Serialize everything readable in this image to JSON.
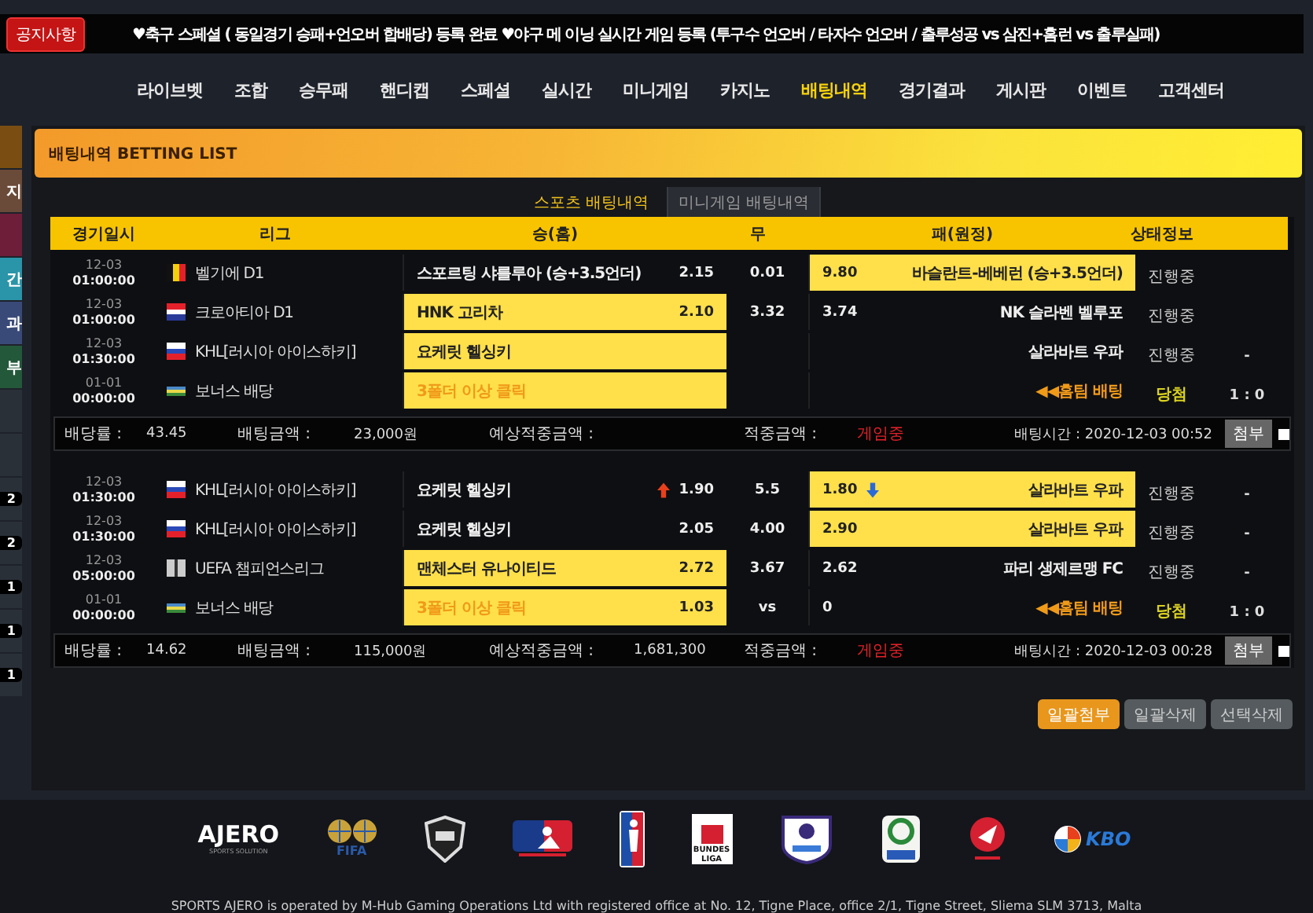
{
  "notice": {
    "badge": "공지사항",
    "text": "♥축구 스페셜 ( 동일경기 승패+언오버 합배당) 등록 완료  ♥야구 메 이닝 실시간 게임 등록 (투구수 언오버 / 타자수 언오버 / 출루성공 vs 삼진+홈런 vs 출루실패)"
  },
  "nav": [
    {
      "label": "라이브벳",
      "selected": false
    },
    {
      "label": "조합",
      "selected": false
    },
    {
      "label": "승무패",
      "selected": false
    },
    {
      "label": "핸디캡",
      "selected": false
    },
    {
      "label": "스페셜",
      "selected": false
    },
    {
      "label": "실시간",
      "selected": false
    },
    {
      "label": "미니게임",
      "selected": false
    },
    {
      "label": "카지노",
      "selected": false
    },
    {
      "label": "배팅내역",
      "selected": true
    },
    {
      "label": "경기결과",
      "selected": false
    },
    {
      "label": "게시판",
      "selected": false
    },
    {
      "label": "이벤트",
      "selected": false
    },
    {
      "label": "고객센터",
      "selected": false
    }
  ],
  "sidebar": [
    {
      "color": "#7a4e12"
    },
    {
      "label": "지",
      "color": "#6a4a38"
    },
    {
      "color": "#6e1e38"
    },
    {
      "label": "간",
      "color": "#2a94a8"
    },
    {
      "label": "과",
      "color": "#3a4a78"
    },
    {
      "label": "부",
      "color": "#24583a"
    },
    {
      "color": "#2a3038"
    },
    {
      "color": "#2a3038"
    },
    {
      "label": "2",
      "color": "#2a3038"
    },
    {
      "label": "2",
      "color": "#2a3038"
    },
    {
      "label": "1",
      "color": "#2a3038"
    },
    {
      "label": "1",
      "color": "#2a3038"
    },
    {
      "label": "1",
      "color": "#2a3038"
    }
  ],
  "page_title": "배팅내역 BETTING LIST",
  "tabs": [
    {
      "label": "스포츠 배팅내역",
      "selected": true
    },
    {
      "label": "미니게임 배팅내역",
      "selected": false
    }
  ],
  "columns": [
    "경기일시",
    "리그",
    "승(홈)",
    "무",
    "패(원정)",
    "상태정보"
  ],
  "bets": [
    {
      "rows": [
        {
          "date": "12-03",
          "time": "01:00:00",
          "flag": {
            "kind": "belgium"
          },
          "league": "벨기에 D1",
          "home": {
            "name": "스포르팅 샤를루아 (승+3.5언더)",
            "odds": "2.15",
            "selected": false,
            "kind": "team",
            "rising": false,
            "falling": false
          },
          "draw": "0.01",
          "away": {
            "name": "바슬란트-베베런 (승+3.5언더)",
            "odds": "9.80",
            "selected": true,
            "kind": "team",
            "rising": false,
            "falling": false
          },
          "status": "진행중",
          "won": false
        },
        {
          "date": "12-03",
          "time": "01:00:00",
          "flag": {
            "kind": "croatia"
          },
          "league": "크로아티아 D1",
          "home": {
            "name": "HNK 고리차",
            "odds": "2.10",
            "selected": true,
            "kind": "team",
            "rising": false,
            "falling": false
          },
          "draw": "3.32",
          "away": {
            "name": "NK 슬라벤 벨루포",
            "odds": "3.74",
            "selected": false,
            "kind": "team",
            "rising": false,
            "falling": false
          },
          "status": "진행중",
          "won": false
        },
        {
          "date": "12-03",
          "time": "01:30:00",
          "flag": {
            "kind": "russia"
          },
          "league": "KHL[러시아 아이스하키]",
          "home": {
            "name": "요케릿 헬싱키",
            "selected": true,
            "kind": "team",
            "rising": false,
            "falling": false
          },
          "away": {
            "name": "살라바트 우파",
            "selected": false,
            "kind": "team",
            "rising": false,
            "falling": false
          },
          "status": "진행중",
          "won": false,
          "score": "-"
        },
        {
          "date": "01-01",
          "time": "00:00:00",
          "flag": {
            "kind": "bonus"
          },
          "league": "보너스 배당",
          "home": {
            "name": "3폴더 이상 클릭",
            "selected": true,
            "kind": "bonus",
            "rising": false,
            "falling": false
          },
          "away": {
            "name": "◀◀홈팀 배팅",
            "selected": false,
            "kind": "bonus",
            "rising": false,
            "falling": false
          },
          "status": "당첨",
          "won": true,
          "score": "1 : 0"
        }
      ],
      "summary": {
        "rate_label": "배당률 :",
        "rate": "43.45",
        "amount_label": "배팅금액 :",
        "amount": "23,000원",
        "expected_label": "예상적중금액 :",
        "win_label": "적중금액 :",
        "win": "게임중",
        "time": "배팅시간 : 2020-12-03 00:52",
        "attach": "첨부",
        "checked": false
      }
    },
    {
      "rows": [
        {
          "date": "12-03",
          "time": "01:30:00",
          "flag": {
            "kind": "russia"
          },
          "league": "KHL[러시아 아이스하키]",
          "home": {
            "name": "요케릿 헬싱키",
            "odds": "1.90",
            "selected": false,
            "kind": "team",
            "rising": true,
            "falling": false
          },
          "draw": "5.5",
          "away": {
            "name": "살라바트 우파",
            "odds": "1.80",
            "selected": true,
            "kind": "team",
            "rising": false,
            "falling": true
          },
          "status": "진행중",
          "won": false,
          "score": "-"
        },
        {
          "date": "12-03",
          "time": "01:30:00",
          "flag": {
            "kind": "russia"
          },
          "league": "KHL[러시아 아이스하키]",
          "home": {
            "name": "요케릿 헬싱키",
            "odds": "2.05",
            "selected": false,
            "kind": "team",
            "rising": false,
            "falling": false
          },
          "draw": "4.00",
          "away": {
            "name": "살라바트 우파",
            "odds": "2.90",
            "selected": true,
            "kind": "team",
            "rising": false,
            "falling": false
          },
          "status": "진행중",
          "won": false,
          "score": "-"
        },
        {
          "date": "12-03",
          "time": "05:00:00",
          "flag": {
            "kind": "uefa"
          },
          "league": "UEFA 챔피언스리그",
          "home": {
            "name": "맨체스터 유나이티드",
            "odds": "2.72",
            "selected": true,
            "kind": "team",
            "rising": false,
            "falling": false
          },
          "draw": "3.67",
          "away": {
            "name": "파리 생제르맹 FC",
            "odds": "2.62",
            "selected": false,
            "kind": "team",
            "rising": false,
            "falling": false
          },
          "status": "진행중",
          "won": false,
          "score": "-"
        },
        {
          "date": "01-01",
          "time": "00:00:00",
          "flag": {
            "kind": "bonus"
          },
          "league": "보너스 배당",
          "home": {
            "name": "3폴더 이상 클릭",
            "odds": "1.03",
            "selected": true,
            "kind": "bonus",
            "rising": false,
            "falling": false
          },
          "draw": "vs",
          "away": {
            "name": "◀◀홈팀 배팅",
            "odds": "0",
            "selected": false,
            "kind": "bonus",
            "rising": false,
            "falling": false
          },
          "status": "당첨",
          "won": true,
          "score": "1 : 0"
        }
      ],
      "summary": {
        "rate_label": "배당률 :",
        "rate": "14.62",
        "amount_label": "배팅금액 :",
        "amount": "115,000원",
        "expected_label": "예상적중금액 :",
        "expected": "1,681,300",
        "win_label": "적중금액 :",
        "win": "게임중",
        "time": "배팅시간 : 2020-12-03 00:28",
        "attach": "첨부",
        "checked": false
      }
    }
  ],
  "actions": [
    {
      "label": "일괄첨부",
      "kind": "primary"
    },
    {
      "label": "일괄삭제",
      "kind": "secondary"
    },
    {
      "label": "선택삭제",
      "kind": "secondary"
    }
  ],
  "footer": {
    "logos": [
      {
        "kind": "ajero",
        "text": "AJERO",
        "sub": "SPORTS SOLUTION"
      },
      {
        "kind": "fifa",
        "text": "FIFA"
      },
      {
        "kind": "nhl"
      },
      {
        "kind": "mlb"
      },
      {
        "kind": "nba"
      },
      {
        "kind": "bundesliga",
        "text": "BUNDES LIGA"
      },
      {
        "kind": "epl"
      },
      {
        "kind": "seriea"
      },
      {
        "kind": "kleague"
      },
      {
        "kind": "kbo",
        "text": "KBO"
      }
    ],
    "text": "SPORTS AJERO is operated by M-Hub Gaming Operations Ltd with registered office at No. 12, Tigne Place, office 2/1, Tigne Street, Sliema SLM 3713, Malta"
  }
}
